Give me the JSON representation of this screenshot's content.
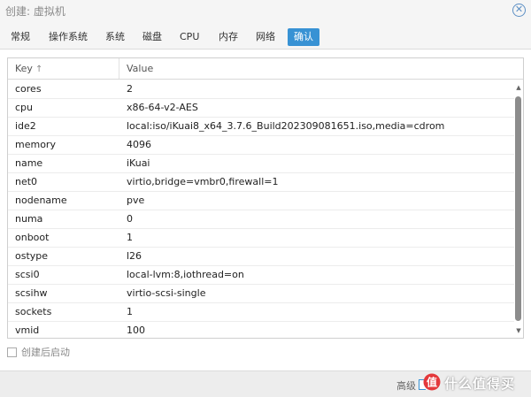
{
  "window": {
    "title": "创建: 虚拟机",
    "close_glyph": "✕"
  },
  "tabs": [
    {
      "label": "常规"
    },
    {
      "label": "操作系统"
    },
    {
      "label": "系统"
    },
    {
      "label": "磁盘"
    },
    {
      "label": "CPU"
    },
    {
      "label": "内存"
    },
    {
      "label": "网络"
    },
    {
      "label": "确认",
      "active": true
    }
  ],
  "grid": {
    "headers": {
      "key": "Key",
      "value": "Value",
      "sort_indicator": "↑"
    },
    "rows": [
      {
        "key": "cores",
        "value": "2"
      },
      {
        "key": "cpu",
        "value": "x86-64-v2-AES"
      },
      {
        "key": "ide2",
        "value": "local:iso/iKuai8_x64_3.7.6_Build202309081651.iso,media=cdrom"
      },
      {
        "key": "memory",
        "value": "4096"
      },
      {
        "key": "name",
        "value": "iKuai"
      },
      {
        "key": "net0",
        "value": "virtio,bridge=vmbr0,firewall=1"
      },
      {
        "key": "nodename",
        "value": "pve"
      },
      {
        "key": "numa",
        "value": "0"
      },
      {
        "key": "onboot",
        "value": "1"
      },
      {
        "key": "ostype",
        "value": "l26"
      },
      {
        "key": "scsi0",
        "value": "local-lvm:8,iothread=on"
      },
      {
        "key": "scsihw",
        "value": "virtio-scsi-single"
      },
      {
        "key": "sockets",
        "value": "1"
      },
      {
        "key": "vmid",
        "value": "100"
      }
    ]
  },
  "options": {
    "start_after_create_label": "创建后启动",
    "start_after_create_checked": false
  },
  "footer": {
    "advanced_label": "高级"
  },
  "watermark": {
    "text": "什么值得买"
  },
  "colors": {
    "accent": "#3892d4",
    "header_bg": "#f5f5f5",
    "footer_bg": "#ededed",
    "scroll_thumb": "#8c8c8c",
    "watermark_red": "#e4393c"
  }
}
